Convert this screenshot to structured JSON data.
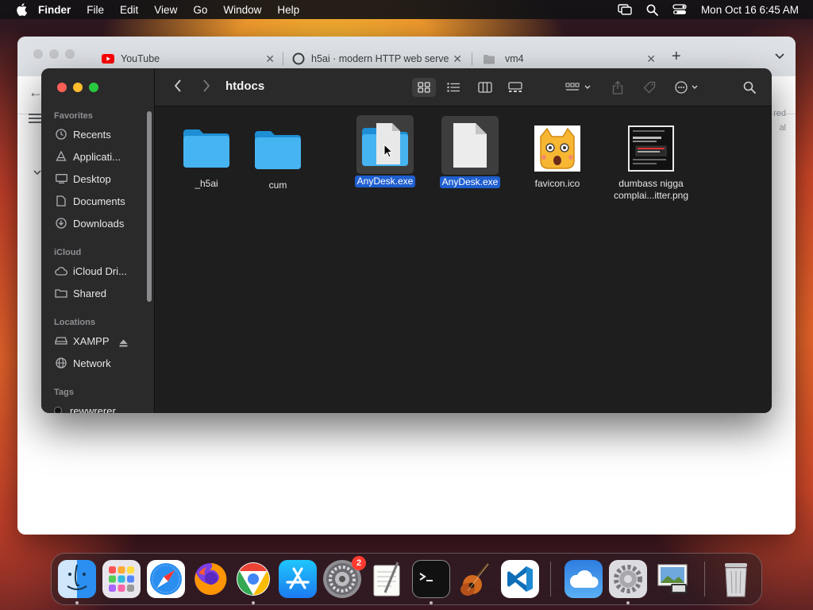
{
  "menubar": {
    "app_name": "Finder",
    "items": [
      "File",
      "Edit",
      "View",
      "Go",
      "Window",
      "Help"
    ],
    "clock": "Mon Oct 16  6:45 AM"
  },
  "browser": {
    "tabs": [
      {
        "title": "YouTube",
        "icon": "youtube-icon"
      },
      {
        "title": "h5ai · modern HTTP web serve",
        "icon": "h5ai-icon"
      },
      {
        "title": "vm4",
        "icon": "folder-icon"
      }
    ],
    "side_text": [
      "red",
      "al"
    ]
  },
  "finder": {
    "title": "htdocs",
    "sidebar": {
      "favorites_label": "Favorites",
      "favorites": [
        {
          "label": "Recents",
          "icon": "clock-icon"
        },
        {
          "label": "Applicati...",
          "icon": "applications-icon"
        },
        {
          "label": "Desktop",
          "icon": "desktop-icon"
        },
        {
          "label": "Documents",
          "icon": "document-icon"
        },
        {
          "label": "Downloads",
          "icon": "download-icon"
        }
      ],
      "icloud_label": "iCloud",
      "icloud": [
        {
          "label": "iCloud Dri...",
          "icon": "cloud-icon"
        },
        {
          "label": "Shared",
          "icon": "shared-folder-icon"
        }
      ],
      "locations_label": "Locations",
      "locations": [
        {
          "label": "XAMPP",
          "icon": "drive-icon"
        },
        {
          "label": "Network",
          "icon": "network-icon"
        }
      ],
      "tags_label": "Tags",
      "tags": [
        {
          "label": "rewwrerer",
          "color": "#111111"
        }
      ]
    },
    "files": [
      {
        "name": "_h5ai",
        "kind": "folder",
        "selected": false
      },
      {
        "name": "cum",
        "kind": "folder",
        "selected": false
      },
      {
        "name": "AnyDesk.exe",
        "kind": "folder-doc",
        "selected": true
      },
      {
        "name": "AnyDesk.exe",
        "kind": "document",
        "selected": true
      },
      {
        "name": "favicon.ico",
        "kind": "image",
        "selected": false
      },
      {
        "name_line1": "dumbass nigga",
        "name_line2": "complai...itter.png",
        "kind": "screenshot",
        "selected": false
      }
    ]
  },
  "dock": {
    "apps": [
      {
        "name": "Finder",
        "icon": "finder-icon",
        "running": true
      },
      {
        "name": "Launchpad",
        "icon": "launchpad-icon",
        "running": false
      },
      {
        "name": "Safari",
        "icon": "safari-icon",
        "running": false
      },
      {
        "name": "Firefox",
        "icon": "firefox-icon",
        "running": false
      },
      {
        "name": "Chrome",
        "icon": "chrome-icon",
        "running": true
      },
      {
        "name": "App Store",
        "icon": "app-store-icon",
        "running": false
      },
      {
        "name": "System Preferences",
        "icon": "settings-icon",
        "running": false,
        "badge": "2"
      },
      {
        "name": "TextEdit",
        "icon": "textedit-icon",
        "running": false
      },
      {
        "name": "Terminal",
        "icon": "terminal-icon",
        "running": true
      },
      {
        "name": "GarageBand",
        "icon": "guitar-icon",
        "running": false
      },
      {
        "name": "Visual Studio Code",
        "icon": "vscode-icon",
        "running": false
      },
      {
        "name": "Weather",
        "icon": "weather-icon",
        "running": false
      },
      {
        "name": "Settings",
        "icon": "gear-icon",
        "running": true
      },
      {
        "name": "Preview",
        "icon": "preview-icon",
        "running": false
      },
      {
        "name": "Trash",
        "icon": "trash-icon",
        "running": false
      }
    ]
  },
  "colors": {
    "selection": "#1f5fcf",
    "finder_bg": "#1e1e1e",
    "sidebar_bg": "#2b2a2b"
  }
}
